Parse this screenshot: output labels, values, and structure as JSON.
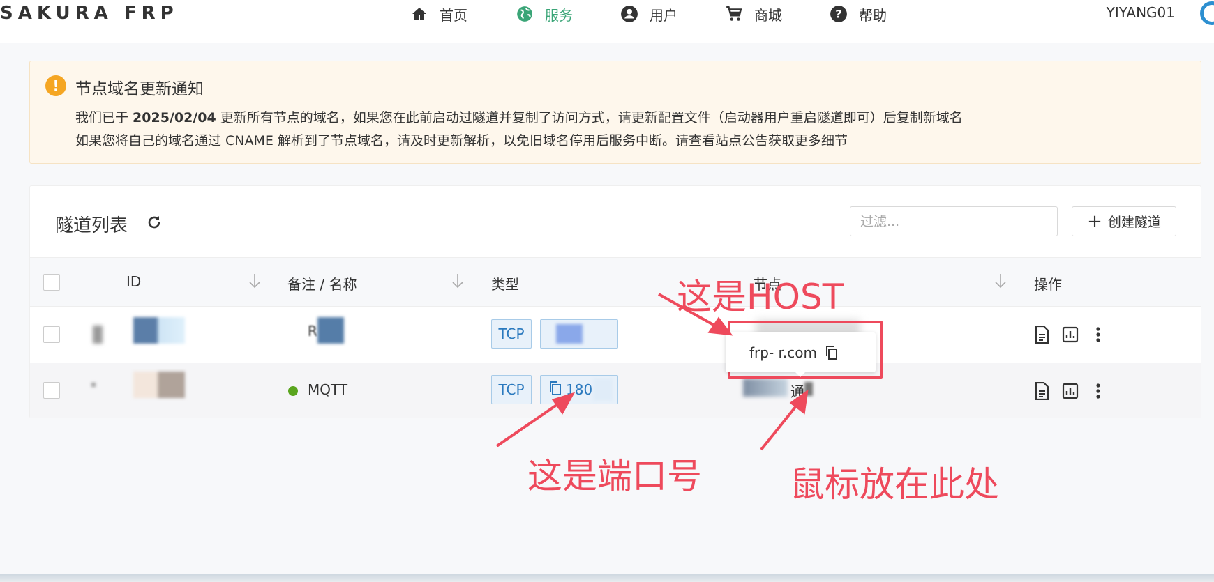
{
  "app": {
    "logo": "SAKURA FRP",
    "user": "YIYANG01"
  },
  "nav": [
    {
      "label": "首页",
      "icon": "home-icon"
    },
    {
      "label": "服务",
      "icon": "globe-icon",
      "active": true
    },
    {
      "label": "用户",
      "icon": "account-icon"
    },
    {
      "label": "商城",
      "icon": "cart-icon"
    },
    {
      "label": "帮助",
      "icon": "help-icon"
    }
  ],
  "notice": {
    "title": "节点域名更新通知",
    "line1_pre": "我们已于 ",
    "line1_date": "2025/02/04",
    "line1_post": " 更新所有节点的域名，如果您在此前启动过隧道并复制了访问方式，请更新配置文件（启动器用户重启隧道即可）后复制新域名",
    "line2": "如果您将自己的域名通过 CNAME 解析到了节点域名，请及时更新解析，以免旧域名停用后服务中断。请查看站点公告获取更多细节"
  },
  "tunnel_list": {
    "title": "隧道列表",
    "filter_placeholder": "过滤...",
    "create_label": "创建隧道",
    "columns": {
      "id": "ID",
      "name": "备注 / 名称",
      "type": "类型",
      "node": "节点",
      "ops": "操作"
    },
    "rows": [
      {
        "type": "TCP",
        "name_partial": "R",
        "node_partial": ""
      },
      {
        "type": "TCP",
        "name": "MQTT",
        "port_partial": "180",
        "node_partial": "通"
      }
    ]
  },
  "tooltip": {
    "host": "frp-  r.com"
  },
  "annotations": {
    "host": "这是HOST",
    "port": "这是端口号",
    "hover": "鼠标放在此处"
  },
  "colors": {
    "accent": "#3aa577",
    "annotation": "#ee4a5c",
    "tag_blue": "#2a79be",
    "warning": "#f5a623"
  }
}
